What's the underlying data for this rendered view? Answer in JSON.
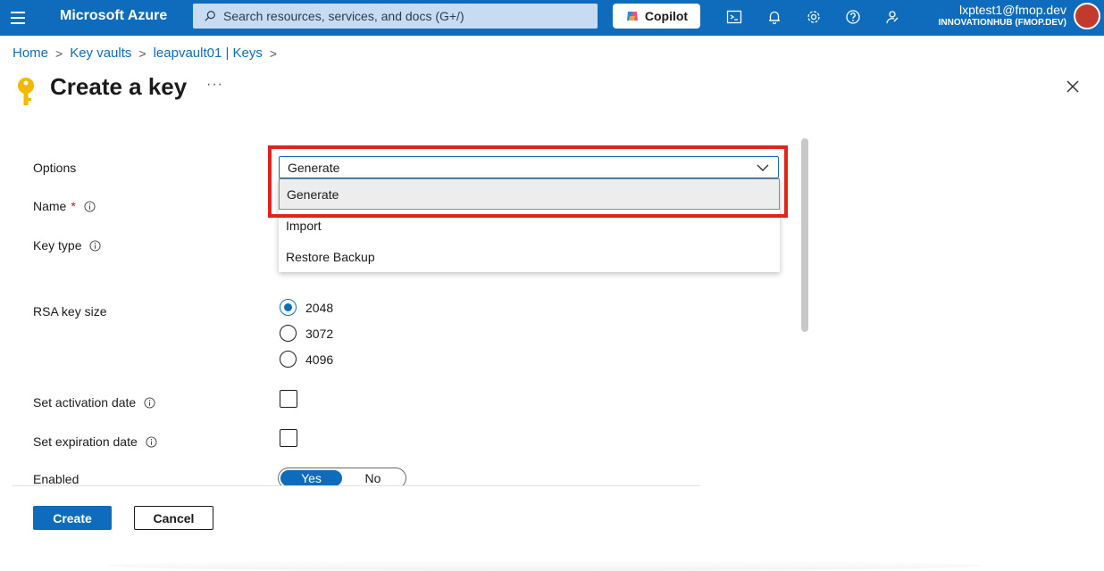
{
  "topbar": {
    "menu_icon": "hamburger-icon",
    "brand": "Microsoft Azure",
    "search_placeholder": "Search resources, services, and docs (G+/)",
    "copilot_label": "Copilot",
    "icons": [
      "cloud-shell-icon",
      "bell-icon",
      "gear-icon",
      "help-icon",
      "feedback-icon"
    ],
    "account_email": "lxptest1@fmop.dev",
    "account_tenant": "INNOVATIONHUB (FMOP.DEV)"
  },
  "breadcrumb": {
    "items": [
      "Home",
      "Key vaults",
      "leapvault01 | Keys"
    ]
  },
  "page": {
    "title": "Create a key",
    "more": "···"
  },
  "form": {
    "options_label": "Options",
    "name_label": "Name",
    "required_mark": "*",
    "key_type_label": "Key type",
    "rsa_key_size_label": "RSA key size",
    "rsa_sizes": [
      "2048",
      "3072",
      "4096"
    ],
    "rsa_selected": "2048",
    "activation_label": "Set activation date",
    "expiration_label": "Set expiration date",
    "enabled_label": "Enabled",
    "enabled_yes": "Yes",
    "enabled_no": "No",
    "enabled_value": "Yes"
  },
  "dropdown": {
    "selected": "Generate",
    "options": [
      "Generate",
      "Import",
      "Restore Backup"
    ]
  },
  "actions": {
    "create": "Create",
    "cancel": "Cancel"
  },
  "colors": {
    "accent": "#0f6cbd",
    "highlight": "#e0241c"
  }
}
